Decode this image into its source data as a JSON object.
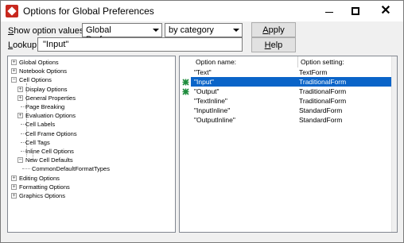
{
  "window": {
    "title": "Options for Global Preferences"
  },
  "toolbar": {
    "show_label_pre": "S",
    "show_label_rest": "how option values for:",
    "scope_value": "Global Preferences",
    "view_value": "by category",
    "apply_label_pre": "A",
    "apply_label_rest": "pply",
    "lookup_label_pre": "L",
    "lookup_label_rest": "ookup:",
    "lookup_value": "\"Input\"",
    "help_label_pre": "H",
    "help_label_rest": "elp"
  },
  "tree": [
    {
      "label": "Global Options",
      "expander": "+"
    },
    {
      "label": "Notebook Options",
      "expander": "+"
    },
    {
      "label": "Cell Options",
      "expander": "−"
    },
    {
      "label": "Display Options",
      "expander": "+"
    },
    {
      "label": "General Properties",
      "expander": "+"
    },
    {
      "label": "Page Breaking",
      "expander": ""
    },
    {
      "label": "Evaluation Options",
      "expander": "+"
    },
    {
      "label": "Cell Labels",
      "expander": ""
    },
    {
      "label": "Cell Frame Options",
      "expander": ""
    },
    {
      "label": "Cell Tags",
      "expander": ""
    },
    {
      "label": "Inline Cell Options",
      "expander": ""
    },
    {
      "label": "New Cell Defaults",
      "expander": "−"
    },
    {
      "label": "CommonDefaultFormatTypes",
      "expander": ""
    },
    {
      "label": "Editing Options",
      "expander": "+"
    },
    {
      "label": "Formatting Options",
      "expander": "+"
    },
    {
      "label": "Graphics Options",
      "expander": "+"
    }
  ],
  "list": {
    "col_name": "Option name:",
    "col_setting": "Option setting:",
    "rows": [
      {
        "name": "\"Text\"",
        "setting": "TextForm",
        "modified": false,
        "selected": false
      },
      {
        "name": "\"Input\"",
        "setting": "TraditionalForm",
        "modified": true,
        "selected": true
      },
      {
        "name": "\"Output\"",
        "setting": "TraditionalForm",
        "modified": true,
        "selected": false
      },
      {
        "name": "\"TextInline\"",
        "setting": "TraditionalForm",
        "modified": false,
        "selected": false
      },
      {
        "name": "\"InputInline\"",
        "setting": "StandardForm",
        "modified": false,
        "selected": false
      },
      {
        "name": "\"OutputInline\"",
        "setting": "StandardForm",
        "modified": false,
        "selected": false
      }
    ]
  },
  "colors": {
    "selection": "#0a64c8",
    "modified_mark": "#1e8c3c",
    "app_icon": "#c8281e"
  }
}
